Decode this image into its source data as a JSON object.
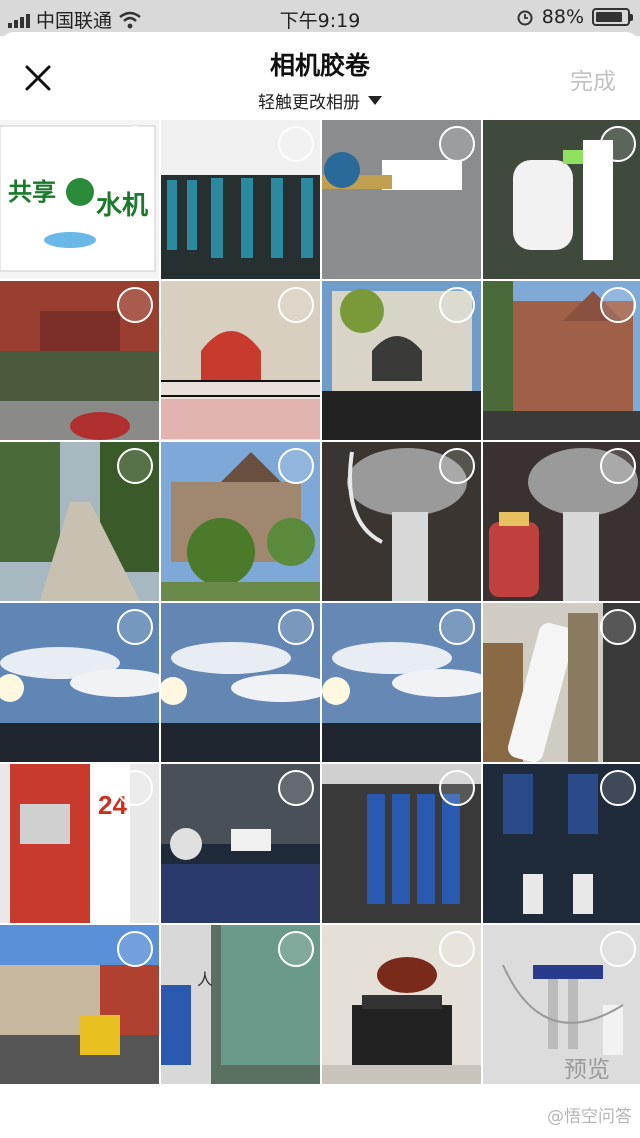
{
  "status_bar": {
    "carrier": "中国联通",
    "time": "下午9:19",
    "battery": "88%",
    "battery_level": 0.88
  },
  "header": {
    "title": "相机胶卷",
    "subtitle": "轻触更改相册",
    "close_icon": "close-icon",
    "done_label": "完成"
  },
  "photos": [
    {
      "desc": "water dispenser box",
      "bg": "#e8eef3"
    },
    {
      "desc": "vending machines row",
      "bg": "#2e3a3a"
    },
    {
      "desc": "water pipe fitting",
      "bg": "#7c7e80"
    },
    {
      "desc": "filter tank",
      "bg": "#4b5c48"
    },
    {
      "desc": "red gate building",
      "bg": "#8a3f32"
    },
    {
      "desc": "red doorway building",
      "bg": "#b24236"
    },
    {
      "desc": "church facade",
      "bg": "#b9b6ad"
    },
    {
      "desc": "brick building",
      "bg": "#a07055"
    },
    {
      "desc": "tree lined path",
      "bg": "#6b7a4f"
    },
    {
      "desc": "stone house",
      "bg": "#7b8f6a"
    },
    {
      "desc": "under sink filter",
      "bg": "#4d4540"
    },
    {
      "desc": "filter with bottle",
      "bg": "#4a3f3a"
    },
    {
      "desc": "sky clouds 1",
      "bg": "#6688b0"
    },
    {
      "desc": "sky clouds 2",
      "bg": "#6a8bb2"
    },
    {
      "desc": "sky clouds 3",
      "bg": "#6b8cb3"
    },
    {
      "desc": "filter cartridges",
      "bg": "#7a6a55"
    },
    {
      "desc": "water kiosk",
      "bg": "#c93a2e"
    },
    {
      "desc": "blue filter tanks",
      "bg": "#2d3b4f"
    },
    {
      "desc": "blue filter row",
      "bg": "#3a4a6a"
    },
    {
      "desc": "filter unit bottles",
      "bg": "#2f3a4a"
    },
    {
      "desc": "street with truck",
      "bg": "#8a7058"
    },
    {
      "desc": "building entrance",
      "bg": "#5c6e63"
    },
    {
      "desc": "bull statue",
      "bg": "#d8d4cc"
    },
    {
      "desc": "wall mounted filter",
      "bg": "#d5d5d5"
    }
  ],
  "footer": {
    "preview_label": "预览",
    "watermark": "@悟空问答"
  }
}
